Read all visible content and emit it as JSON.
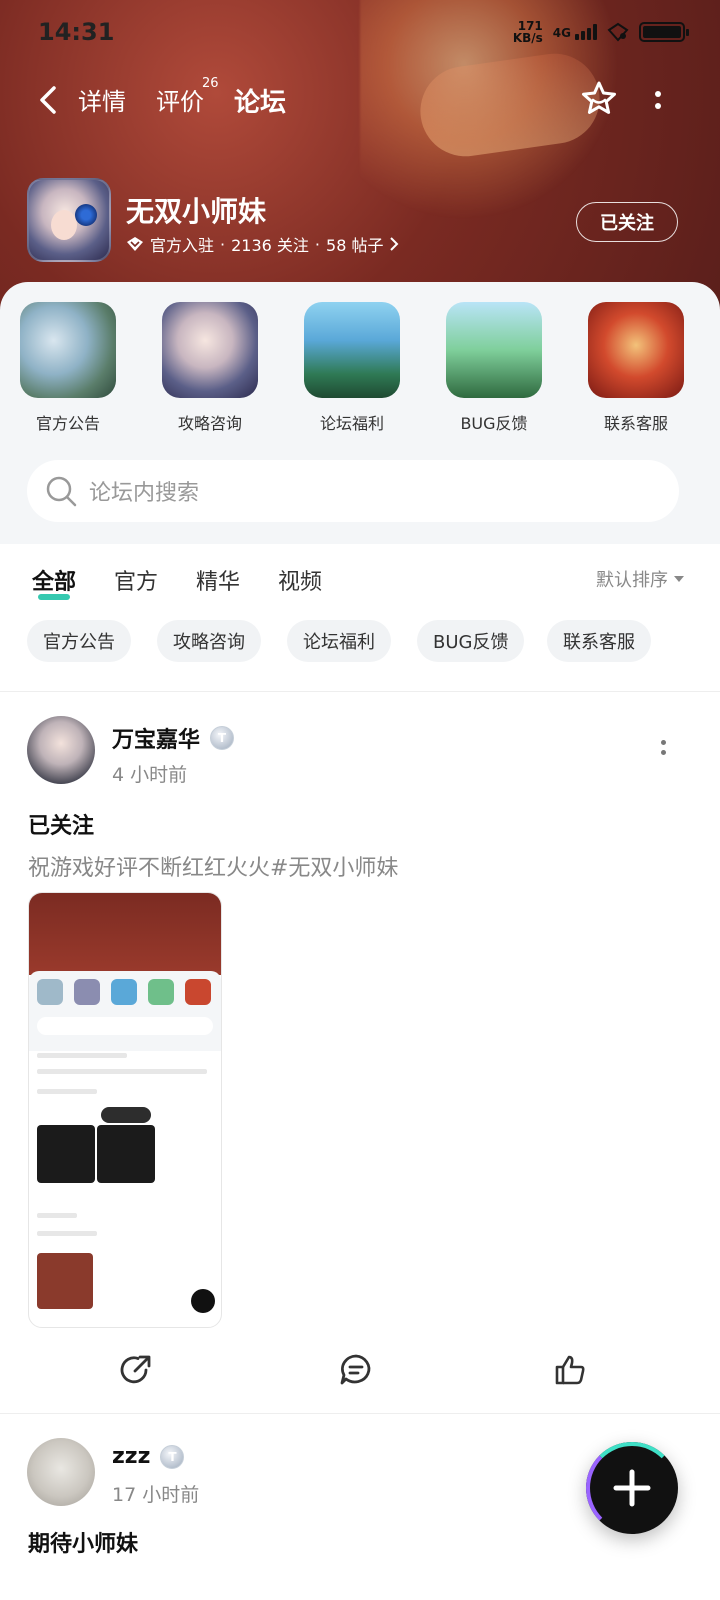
{
  "status_bar": {
    "time": "14:31",
    "net_speed": "171",
    "net_unit": "KB/s",
    "network": "4G"
  },
  "nav": {
    "tabs": [
      {
        "label": "详情",
        "active": false
      },
      {
        "label": "评价",
        "active": false,
        "badge": "26"
      },
      {
        "label": "论坛",
        "active": true
      }
    ],
    "icons": [
      "back-icon",
      "star-icon",
      "more-icon"
    ]
  },
  "game": {
    "name": "无双小师妹",
    "official_label": "官方入驻",
    "followers": "2136 关注",
    "posts": "58 帖子",
    "follow_button": "已关注"
  },
  "categories": [
    {
      "label": "官方公告"
    },
    {
      "label": "攻略咨询"
    },
    {
      "label": "论坛福利"
    },
    {
      "label": "BUG反馈"
    },
    {
      "label": "联系客服"
    }
  ],
  "search": {
    "placeholder": "论坛内搜索"
  },
  "filter": {
    "tabs": [
      {
        "label": "全部",
        "active": true
      },
      {
        "label": "官方",
        "active": false
      },
      {
        "label": "精华",
        "active": false
      },
      {
        "label": "视频",
        "active": false
      }
    ],
    "sort_label": "默认排序",
    "chips": [
      "官方公告",
      "攻略咨询",
      "论坛福利",
      "BUG反馈",
      "联系客服"
    ]
  },
  "posts": [
    {
      "author": "万宝嘉华",
      "level_letter": "T",
      "time": "4 小时前",
      "title": "已关注",
      "body": "祝游戏好评不断红红火火#无双小师妹",
      "actions": [
        "share-icon",
        "comment-icon",
        "like-icon"
      ]
    },
    {
      "author": "zzz",
      "level_letter": "T",
      "time": "17 小时前",
      "title": "期待小师妹"
    }
  ],
  "colors": {
    "accent": "#35c9b0",
    "header_bg": "#7a2a22",
    "panel_bg": "#f4f6f8"
  }
}
